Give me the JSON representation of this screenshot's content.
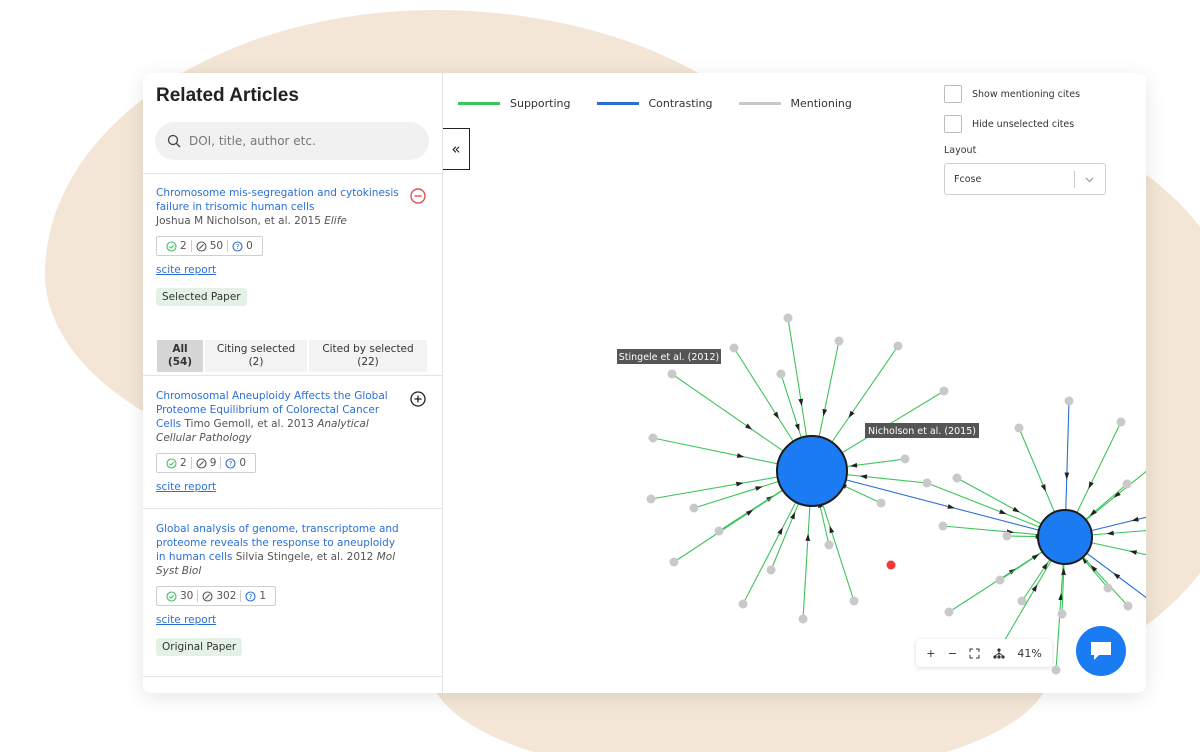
{
  "sidebar": {
    "title": "Related Articles",
    "search_placeholder": "DOI, title, author etc.",
    "selected_article": {
      "title": "Chromosome mis-segregation and cytokinesis failure in trisomic human cells",
      "authors": "Joshua M Nicholson, et al. 2015",
      "journal": "Elife",
      "supporting": "2",
      "mentioning": "50",
      "contrasting": "0",
      "report_link": "scite report",
      "tag": "Selected Paper"
    },
    "tabs": [
      {
        "label": "All",
        "count": "(54)"
      },
      {
        "label": "Citing selected",
        "count": "(2)"
      },
      {
        "label": "Cited by selected",
        "count": "(22)"
      }
    ],
    "articles": [
      {
        "title": "Chromosomal Aneuploidy Affects the Global Proteome Equilibrium of Colorectal Cancer Cells",
        "authors": "Timo Gemoll, et al. 2013",
        "journal": "Analytical Cellular Pathology",
        "supporting": "2",
        "mentioning": "9",
        "contrasting": "0",
        "report_link": "scite report"
      },
      {
        "title": "Global analysis of genome, transcriptome and proteome reveals the response to aneuploidy in human cells",
        "authors": "Silvia Stingele, et al. 2012",
        "journal": "Mol Syst Biol",
        "supporting": "30",
        "mentioning": "302",
        "contrasting": "1",
        "report_link": "scite report",
        "tag": "Original Paper"
      }
    ]
  },
  "collapse_label": "«",
  "legend": [
    {
      "label": "Supporting",
      "color": "#3dc45a"
    },
    {
      "label": "Contrasting",
      "color": "#2a6fd6"
    },
    {
      "label": "Mentioning",
      "color": "#c8c8c8"
    }
  ],
  "options": {
    "show_mentioning": "Show mentioning cites",
    "hide_unselected": "Hide unselected cites",
    "layout_label": "Layout",
    "layout_value": "Fcose"
  },
  "graph": {
    "node_a_label": "Stingele et al. (2012)",
    "node_b_label": "Nicholson et al. (2015)",
    "main_node_color": "#1a7bf2",
    "peripheral_node_color": "#c9c9c9",
    "highlight_node_color": "#f23a3a"
  },
  "zoom": {
    "plus": "+",
    "minus": "−",
    "level": "41%"
  }
}
